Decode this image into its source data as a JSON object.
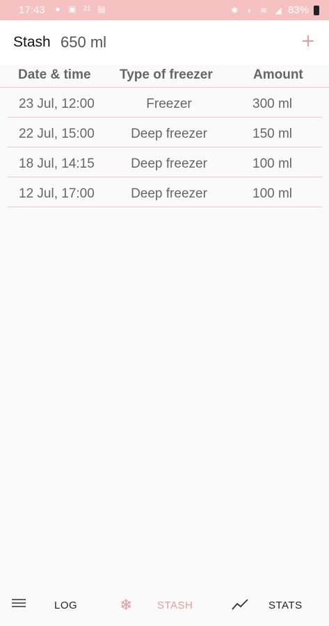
{
  "status_bar": {
    "time": "17:43",
    "battery": "83%",
    "notification_count": "21"
  },
  "app_bar": {
    "title": "Stash",
    "total": "650 ml",
    "add_icon": "plus-icon"
  },
  "table": {
    "headers": [
      "Date & time",
      "Type of freezer",
      "Amount"
    ],
    "rows": [
      {
        "date": "23 Jul, 12:00",
        "type": "Freezer",
        "amount": "300 ml"
      },
      {
        "date": "22 Jul, 15:00",
        "type": "Deep freezer",
        "amount": "150 ml"
      },
      {
        "date": "18 Jul, 14:15",
        "type": "Deep freezer",
        "amount": "100 ml"
      },
      {
        "date": "12 Jul, 17:00",
        "type": "Deep freezer",
        "amount": "100 ml"
      }
    ]
  },
  "bottom_nav": {
    "items": [
      {
        "label": "LOG",
        "icon": "list-icon"
      },
      {
        "label": "STASH",
        "icon": "snowflake-icon",
        "active": true
      },
      {
        "label": "STATS",
        "icon": "trend-line-icon"
      }
    ]
  },
  "colors": {
    "accent": "#e79a9a",
    "status_bar": "#f6c1c1",
    "divider": "#f0c6c6"
  }
}
